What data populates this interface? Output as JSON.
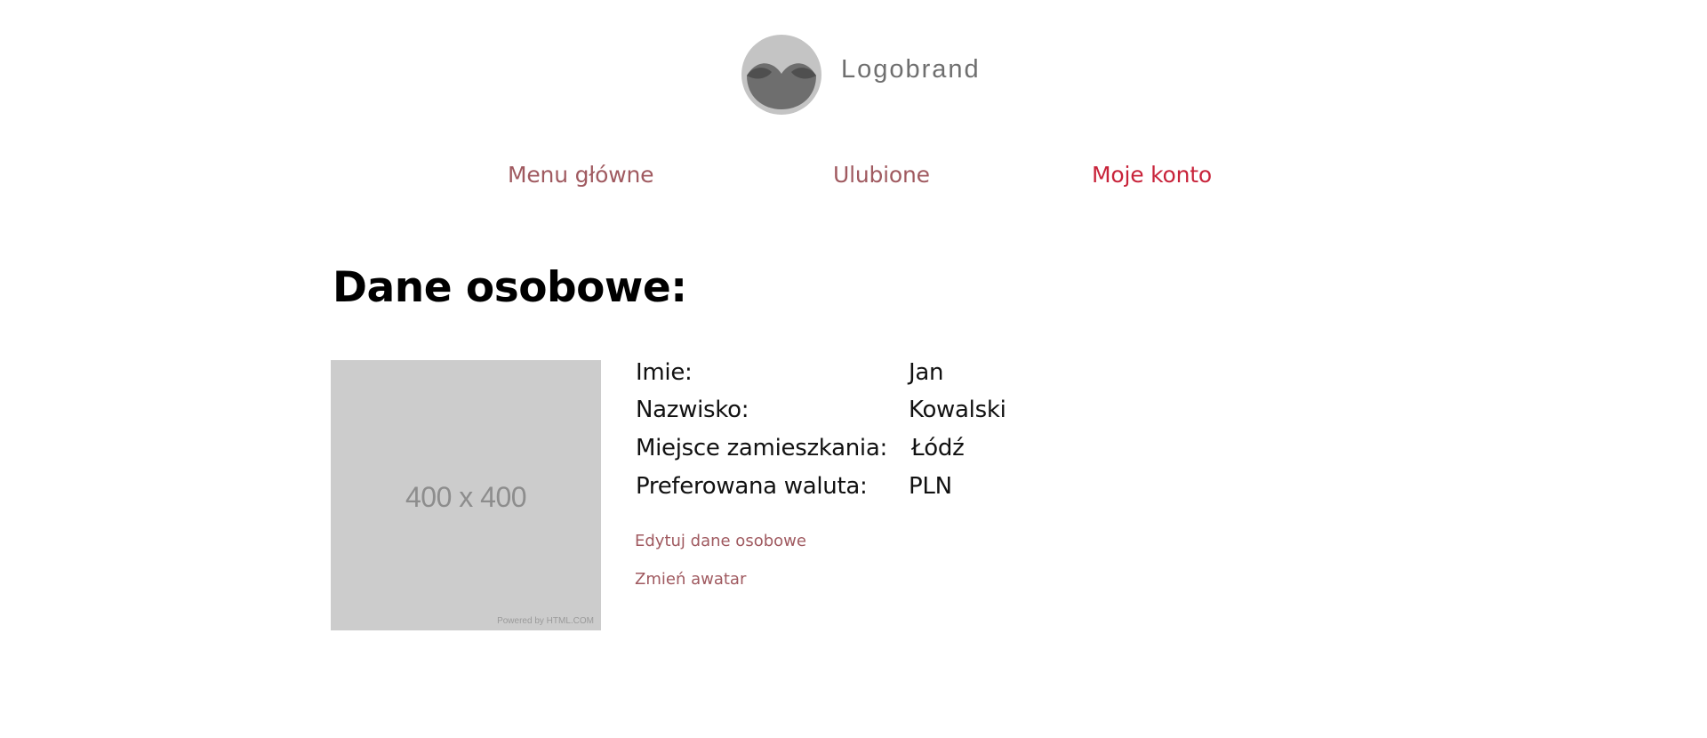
{
  "brand": {
    "logo_icon": "logo-circle-waves-icon",
    "name": "Logobrand"
  },
  "nav": {
    "items": [
      {
        "label": "Menu główne",
        "active": false
      },
      {
        "label": "Ulubione",
        "active": false
      },
      {
        "label": "Moje konto",
        "active": true
      }
    ]
  },
  "page": {
    "title": "Dane osobowe:"
  },
  "avatar": {
    "placeholder_text": "400 x 400",
    "credit": "Powered by HTML.COM"
  },
  "profile": {
    "fields": [
      {
        "label": "Imie:",
        "value": "Jan"
      },
      {
        "label": "Nazwisko:",
        "value": "Kowalski"
      },
      {
        "label": "Miejsce zamieszkania:",
        "value": "Łódź"
      },
      {
        "label": "Preferowana waluta:",
        "value": "PLN"
      }
    ]
  },
  "actions": {
    "edit_label": "Edytuj dane osobowe",
    "change_avatar_label": "Zmień awatar"
  },
  "colors": {
    "nav_link": "#a05a60",
    "nav_active": "#c8233a",
    "avatar_bg": "#cccccc",
    "logo_bg": "#c4c4c4"
  }
}
